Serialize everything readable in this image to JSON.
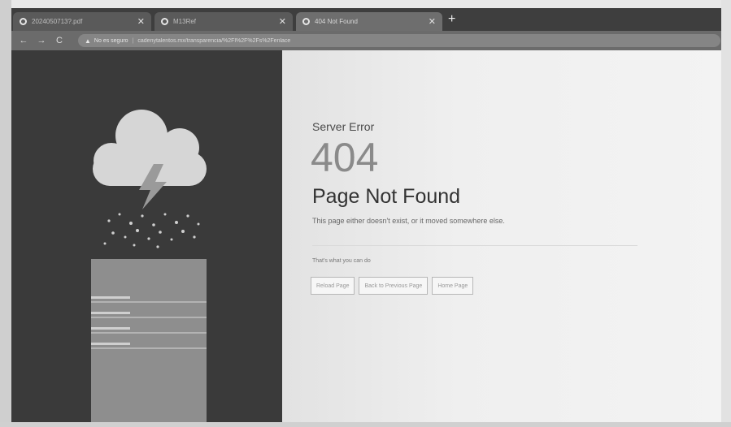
{
  "browser": {
    "tabs": [
      {
        "title": "2024050713?.pdf",
        "close": "✕"
      },
      {
        "title": "M13Ref",
        "close": "✕"
      },
      {
        "title": "404 Not Found",
        "close": "✕"
      }
    ],
    "new_tab": "+",
    "nav": {
      "back": "←",
      "forward": "→",
      "reload": "C"
    },
    "address": {
      "security_label": "No es seguro",
      "url": "cadenytalentos.mx/transparencia/%2Fl%2F%2Fs%2Fenlace"
    }
  },
  "error_page": {
    "eyebrow": "Server Error",
    "code": "404",
    "heading": "Page Not Found",
    "description": "This page either doesn't exist, or it moved somewhere else.",
    "prompt": "That's what you can do",
    "buttons": [
      "Reload Page",
      "Back to Previous Page",
      "Home Page"
    ]
  },
  "colors": {
    "sidebar": "#3a3a3a",
    "page": "#f1f1f1",
    "heading": "#333333",
    "code": "#8a8a8a"
  },
  "icons": [
    "favicon-icon",
    "close-icon",
    "back-icon",
    "forward-icon",
    "reload-icon",
    "not-secure-icon",
    "cloud-icon",
    "lightning-icon",
    "rain-icon",
    "server-tower-icon"
  ]
}
